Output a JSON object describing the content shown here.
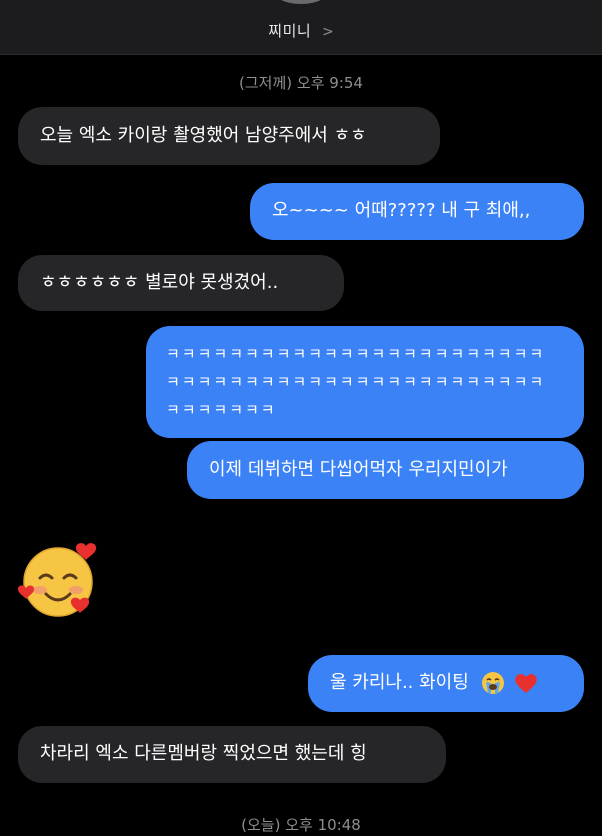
{
  "header": {
    "contact_name": "찌미니",
    "chevron": ">"
  },
  "timestamps": {
    "first": "(그저께) 오후 9:54",
    "second": "(오늘) 오후 10:48"
  },
  "messages": [
    {
      "direction": "incoming",
      "text": "오늘 엑소 카이랑 촬영했어 남양주에서 ㅎㅎ"
    },
    {
      "direction": "outgoing",
      "text": "오~~~~ 어때????? 내 구 최애,,"
    },
    {
      "direction": "incoming",
      "text": "ㅎㅎㅎㅎㅎㅎ 별로야 못생겼어.."
    },
    {
      "direction": "outgoing",
      "lines": [
        "ㅋㅋㅋㅋㅋㅋㅋㅋㅋㅋㅋㅋㅋㅋㅋㅋㅋㅋㅋㅋㅋㅋㅋㅋ",
        "ㅋㅋㅋㅋㅋㅋㅋㅋㅋㅋㅋㅋㅋㅋㅋㅋㅋㅋㅋㅋㅋㅋㅋㅋ",
        "ㅋㅋㅋㅋㅋㅋㅋ"
      ]
    },
    {
      "direction": "outgoing",
      "text": "이제 데뷔하면 다씹어먹자 우리지민이가"
    },
    {
      "direction": "incoming",
      "emoji": "smiling-face-with-hearts"
    },
    {
      "direction": "outgoing",
      "text": "울 카리나.. 화이팅",
      "emojis": [
        "loudly-crying-face",
        "red-heart"
      ]
    },
    {
      "direction": "incoming",
      "text": "차라리 엑소 다른멤버랑 찍었으면 했는데 힝"
    }
  ],
  "colors": {
    "background": "#000000",
    "incoming_bubble": "#262629",
    "outgoing_bubble": "#3b82f6",
    "timestamp": "#8e8e93"
  }
}
